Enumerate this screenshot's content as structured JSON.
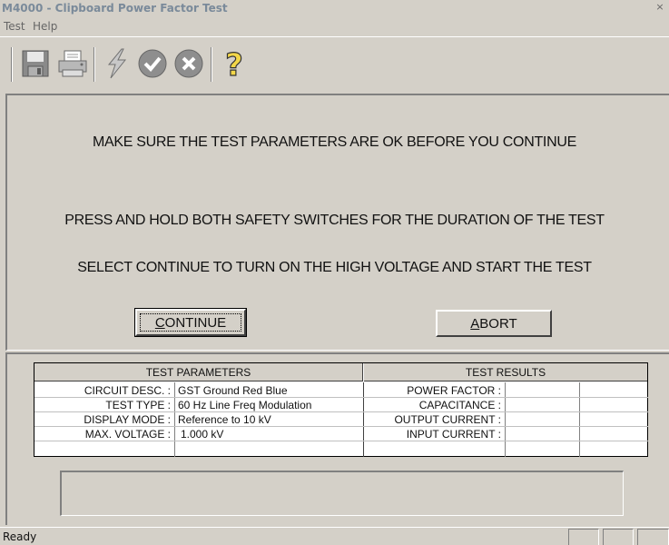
{
  "window": {
    "title": "M4000 - Clipboard Power Factor Test",
    "close_glyph": "×"
  },
  "menu": {
    "items": [
      "Test",
      "Help"
    ]
  },
  "toolbar": {
    "icons": [
      "save-icon",
      "print-icon",
      "lightning-icon",
      "ok-check-icon",
      "cancel-x-icon",
      "help-question-icon"
    ]
  },
  "messages": {
    "line1": "MAKE SURE THE TEST PARAMETERS ARE OK BEFORE YOU CONTINUE",
    "line2": "PRESS AND HOLD BOTH SAFETY SWITCHES FOR THE DURATION OF THE TEST",
    "line3": "SELECT CONTINUE TO TURN ON THE HIGH VOLTAGE AND START THE TEST"
  },
  "buttons": {
    "continue": {
      "mnemonic": "C",
      "rest": "ONTINUE"
    },
    "abort": {
      "mnemonic": "A",
      "rest": "BORT"
    }
  },
  "table": {
    "params_header": "TEST PARAMETERS",
    "results_header": "TEST RESULTS",
    "params": [
      {
        "label": "CIRCUIT DESC. :",
        "value": "GST Ground Red Blue"
      },
      {
        "label": "TEST TYPE :",
        "value": "60 Hz Line Freq Modulation"
      },
      {
        "label": "DISPLAY MODE :",
        "value": "Reference to 10 kV"
      },
      {
        "label": "MAX. VOLTAGE :",
        "value": "1.000 kV"
      }
    ],
    "results": [
      {
        "label": "POWER FACTOR :",
        "value": "",
        "extra": ""
      },
      {
        "label": "CAPACITANCE :",
        "value": "",
        "extra": ""
      },
      {
        "label": "OUTPUT CURRENT :",
        "value": "",
        "extra": ""
      },
      {
        "label": "INPUT CURRENT :",
        "value": "",
        "extra": ""
      }
    ]
  },
  "status": {
    "text": "Ready"
  }
}
